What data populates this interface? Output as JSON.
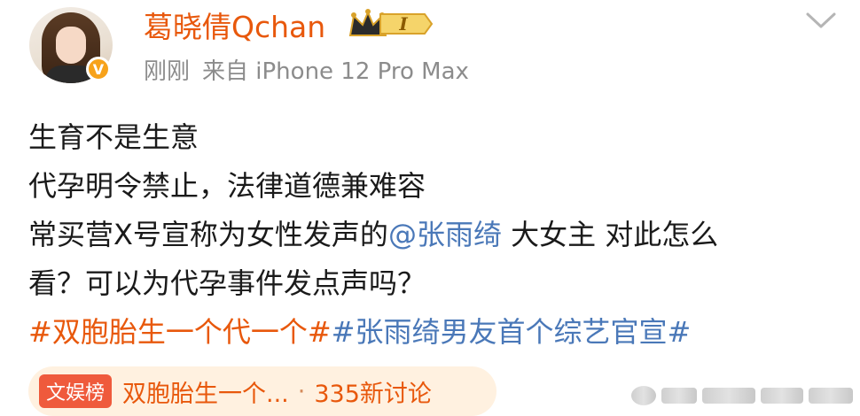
{
  "post": {
    "author": {
      "name": "葛晓倩Qchan",
      "vip_level": "I",
      "verified_mark": "V"
    },
    "meta": {
      "time": "刚刚",
      "source": "来自 iPhone 12 Pro Max"
    },
    "content": {
      "line1": "生育不是生意",
      "line2": "代孕明令禁止，法律道德兼难容",
      "line3_prefix": "常买营X号宣称为女性发声的",
      "mention": "@张雨绮",
      "line3_suffix": " 大女主 对此怎么",
      "line4": "看？可以为代孕事件发点声吗？",
      "hashtag1": "#双胞胎生一个代一个#",
      "hashtag2": "#张雨绮男友首个综艺官宣#"
    },
    "topic_bar": {
      "tag": "文娱榜",
      "title": "双胞胎生一个...",
      "separator": "·",
      "count": "335新讨论"
    }
  },
  "icons": {
    "vip": "crown-vip-badge-icon",
    "more": "chevron-down-icon",
    "verified": "verified-badge-icon"
  },
  "colors": {
    "username": "#e8580c",
    "link": "#4a78b8",
    "hashtag_orange": "#e8580c",
    "topic_bg": "#fff1e0",
    "topic_tag_bg": "#ef5a3c",
    "meta_text": "#8c8c8c"
  }
}
